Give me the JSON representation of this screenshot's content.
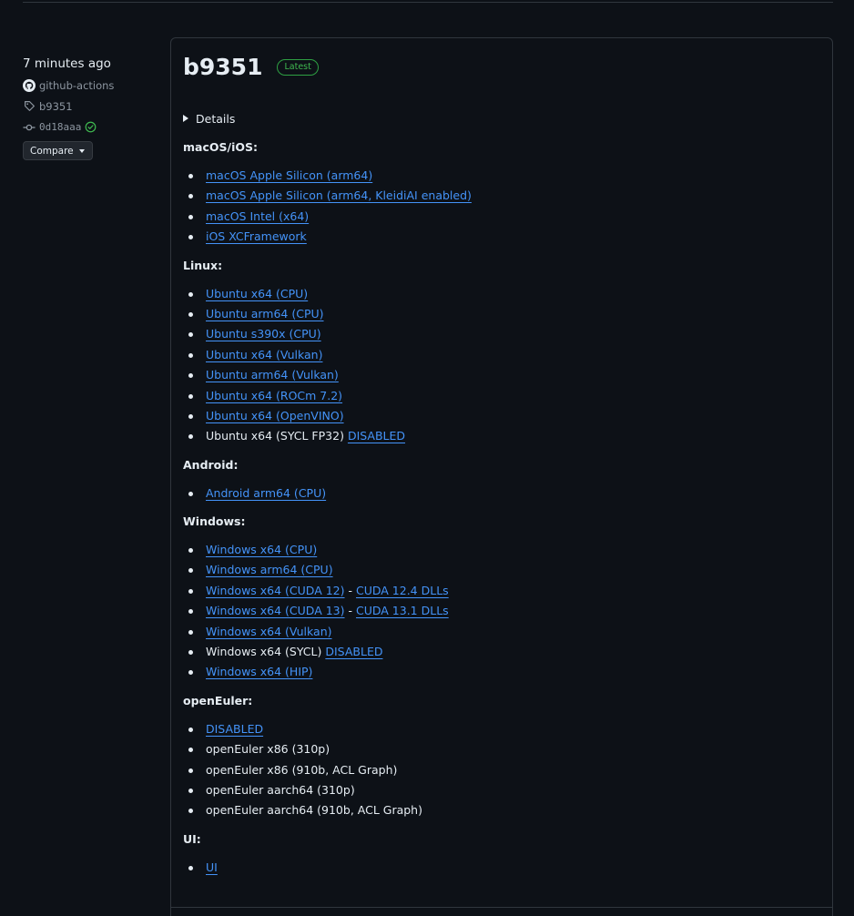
{
  "meta": {
    "time": "7 minutes ago",
    "author": "github-actions",
    "tag": "b9351",
    "commit": "0d18aaa",
    "compare_label": "Compare"
  },
  "release": {
    "title": "b9351",
    "badge": "Latest",
    "details_label": "Details"
  },
  "sections": {
    "macos": {
      "heading": "macOS/iOS:",
      "items": [
        "macOS Apple Silicon (arm64)",
        "macOS Apple Silicon (arm64, KleidiAI enabled)",
        "macOS Intel (x64)",
        "iOS XCFramework"
      ]
    },
    "linux": {
      "heading": "Linux:",
      "items": [
        "Ubuntu x64 (CPU)",
        "Ubuntu arm64 (CPU)",
        "Ubuntu s390x (CPU)",
        "Ubuntu x64 (Vulkan)",
        "Ubuntu arm64 (Vulkan)",
        "Ubuntu x64 (ROCm 7.2)",
        "Ubuntu x64 (OpenVINO)"
      ],
      "sycl_text": "Ubuntu x64 (SYCL FP32)",
      "sycl_link": "DISABLED"
    },
    "android": {
      "heading": "Android:",
      "items": [
        "Android arm64 (CPU)"
      ]
    },
    "windows": {
      "heading": "Windows:",
      "items": [
        "Windows x64 (CPU)",
        "Windows arm64 (CPU)"
      ],
      "cuda12": "Windows x64 (CUDA 12)",
      "cuda12_dlls": "CUDA 12.4 DLLs",
      "cuda13": "Windows x64 (CUDA 13)",
      "cuda13_dlls": "CUDA 13.1 DLLs",
      "separator": "-",
      "vulkan": "Windows x64 (Vulkan)",
      "sycl_text": "Windows x64 (SYCL)",
      "sycl_link": "DISABLED",
      "hip": "Windows x64 (HIP)"
    },
    "openeuler": {
      "heading": "openEuler:",
      "disabled_link": "DISABLED",
      "items": [
        "openEuler x86 (310p)",
        "openEuler x86 (910b, ACL Graph)",
        "openEuler aarch64 (310p)",
        "openEuler aarch64 (910b, ACL Graph)"
      ]
    },
    "ui": {
      "heading": "UI:",
      "link": "UI"
    }
  },
  "colors": {
    "background": "#0d1117",
    "link": "#4493f8",
    "latest_badge": "#3fb950",
    "border": "#30363d"
  },
  "icons": {
    "author": "github-mark-icon",
    "tag": "tag-icon",
    "commit": "git-commit-icon",
    "verified": "check-circle-icon",
    "details": "disclosure-triangle-icon",
    "compare": "caret-down-icon"
  }
}
